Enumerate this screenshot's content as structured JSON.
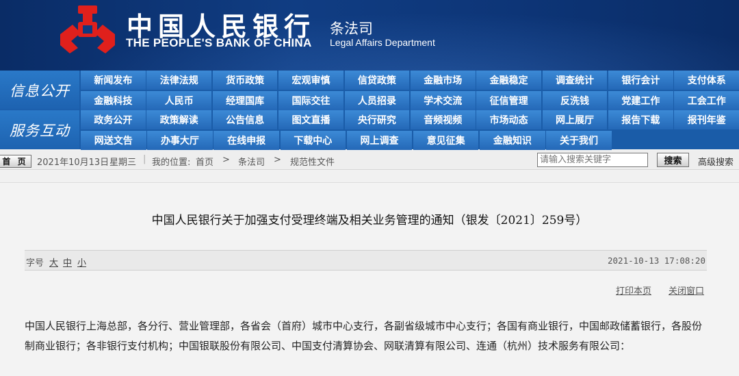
{
  "header": {
    "bank_name_cn": "中国人民银行",
    "bank_name_en": "THE PEOPLE'S BANK OF CHINA",
    "dept_name_cn": "条法司",
    "dept_name_en": "Legal Affairs Department",
    "logo_icon": "pboc-logo-icon",
    "logo_color": "#e0201c"
  },
  "nav": {
    "group1_label": "信息公开",
    "group2_label": "服务互动",
    "rows": [
      [
        "新闻发布",
        "法律法规",
        "货币政策",
        "宏观审慎",
        "信贷政策",
        "金融市场",
        "金融稳定",
        "调查统计",
        "银行会计",
        "支付体系"
      ],
      [
        "金融科技",
        "人民币",
        "经理国库",
        "国际交往",
        "人员招录",
        "学术交流",
        "征信管理",
        "反洗钱",
        "党建工作",
        "工会工作"
      ],
      [
        "政务公开",
        "政策解读",
        "公告信息",
        "图文直播",
        "央行研究",
        "音频视频",
        "市场动态",
        "网上展厅",
        "报告下载",
        "报刊年鉴"
      ],
      [
        "网送文告",
        "办事大厅",
        "在线申报",
        "下载中心",
        "网上调查",
        "意见征集",
        "金融知识",
        "关于我们"
      ]
    ]
  },
  "infobar": {
    "home_label": "首 页",
    "date": "2021年10月13日",
    "weekday": "星期三",
    "location_label": "我的位置:",
    "crumbs": [
      "首页",
      "条法司",
      "规范性文件"
    ],
    "crumb_separator": ">",
    "search_placeholder": "请输入搜索关键字",
    "search_button": "搜索",
    "advanced_search": "高级搜索"
  },
  "article": {
    "title": "中国人民银行关于加强支付受理终端及相关业务管理的通知（银发〔2021〕259号）",
    "font_size_label": "字号",
    "font_sizes": [
      "大",
      "中",
      "小"
    ],
    "published": "2021-10-13 17:08:20",
    "print_label": "打印本页",
    "close_label": "关闭窗口",
    "body": "中国人民银行上海总部，各分行、营业管理部，各省会（首府）城市中心支行，各副省级城市中心支行；各国有商业银行，中国邮政储蓄银行，各股份制商业银行；各非银行支付机构；中国银联股份有限公司、中国支付清算协会、网联清算有限公司、连通（杭州）技术服务有限公司："
  }
}
